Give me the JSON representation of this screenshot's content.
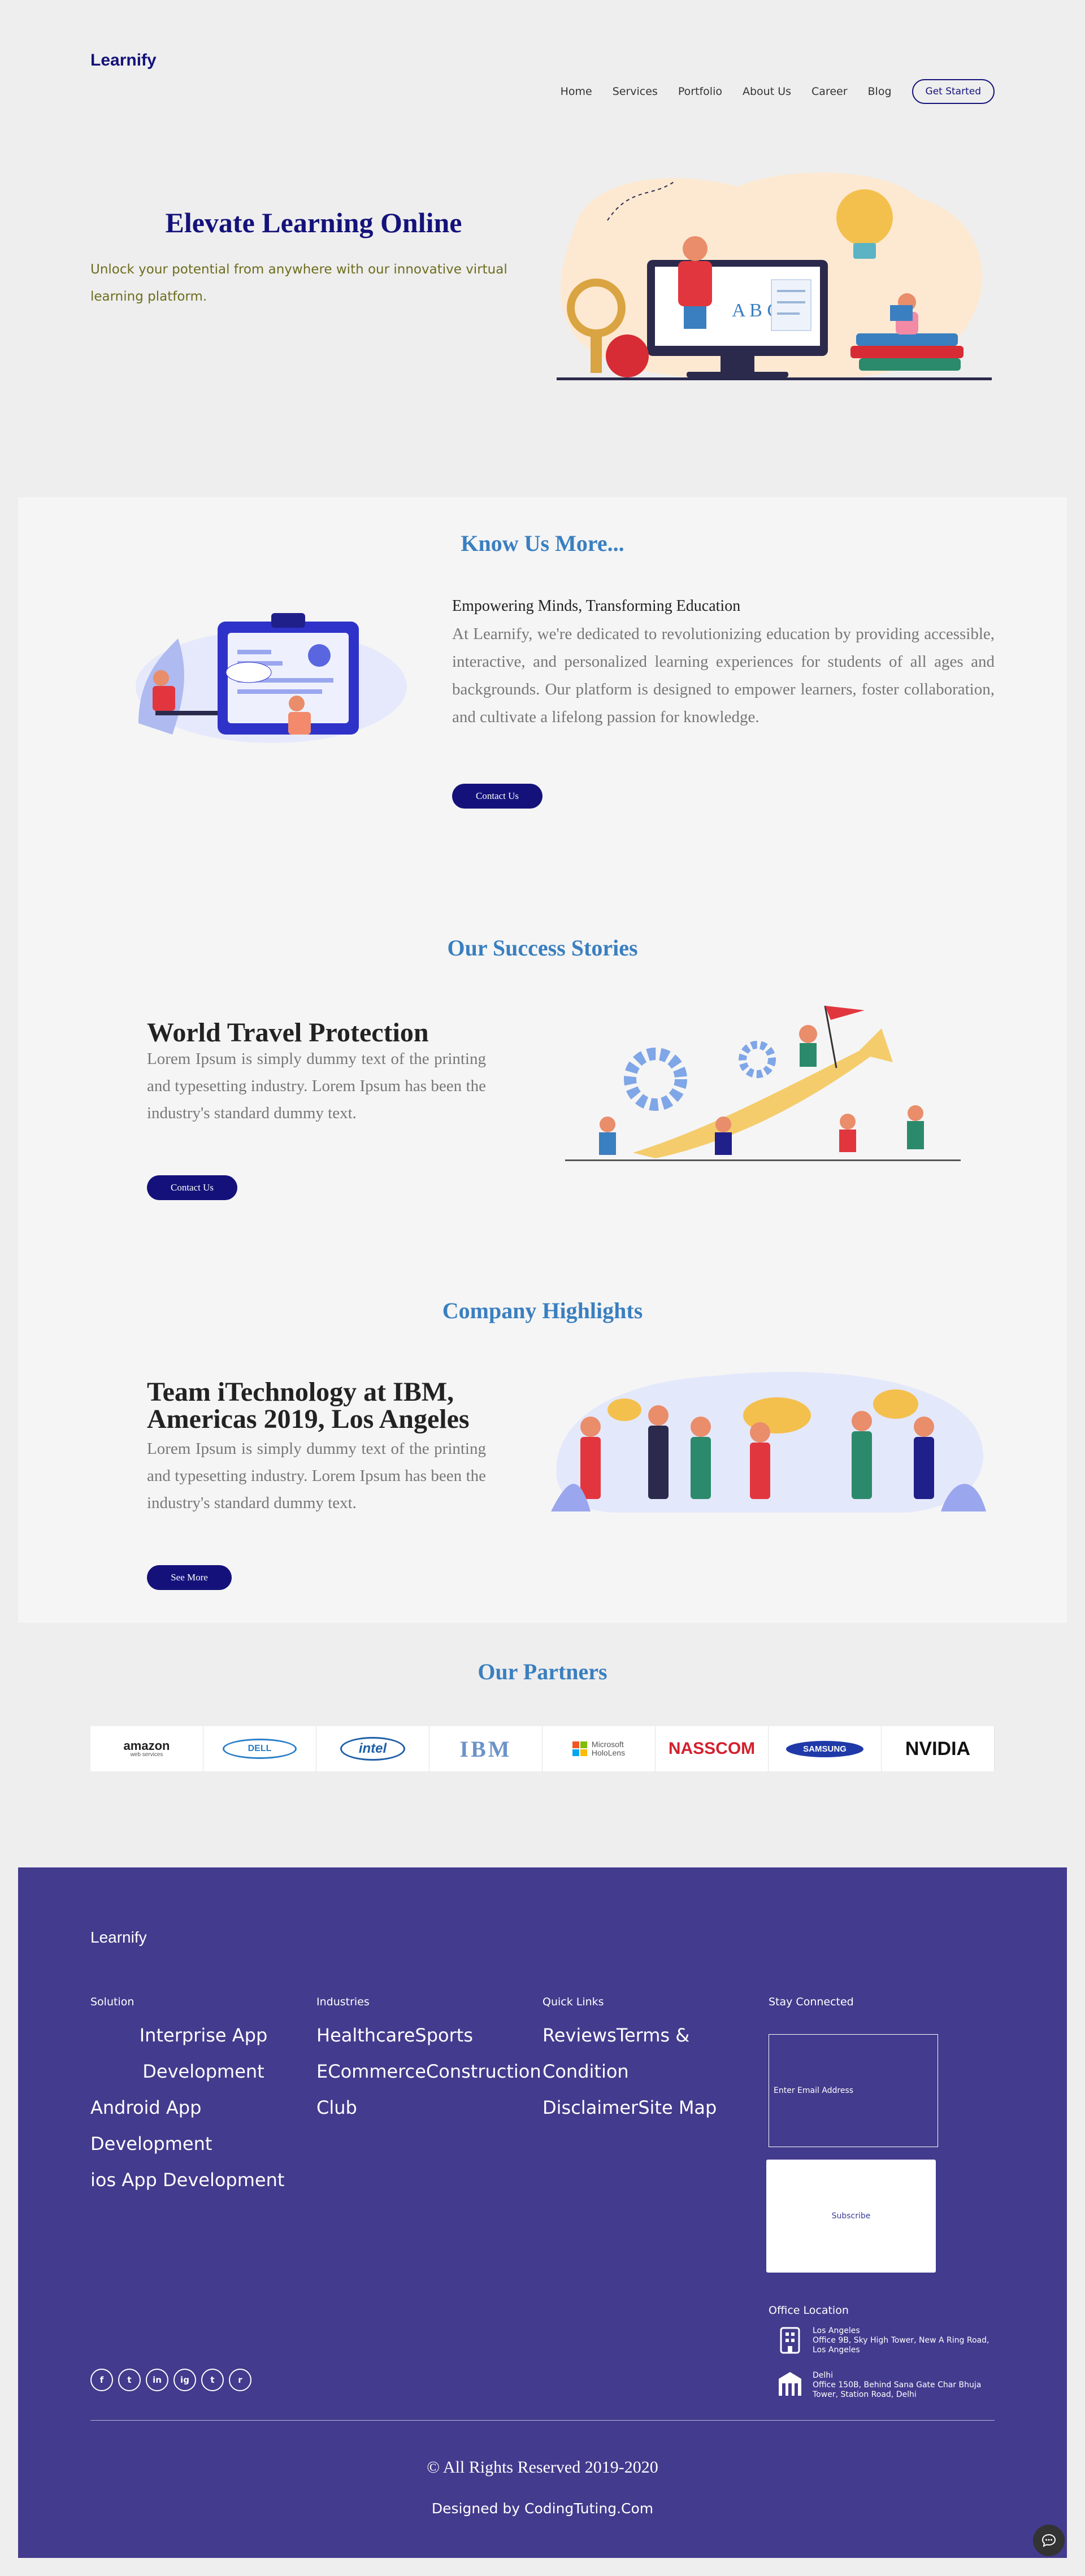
{
  "brand": "Learnify",
  "nav": {
    "items": [
      "Home",
      "Services",
      "Portfolio",
      "About Us",
      "Career",
      "Blog"
    ],
    "cta": "Get Started"
  },
  "hero": {
    "title": "Elevate Learning Online",
    "subtitle": "Unlock your potential from anywhere with our innovative virtual learning platform."
  },
  "know": {
    "title": "Know Us More...",
    "heading": "Empowering Minds, Transforming Education",
    "body": "At Learnify, we're dedicated to revolutionizing education by providing accessible, interactive, and personalized learning experiences for students of all ages and backgrounds. Our platform is designed to empower learners, foster collaboration, and cultivate a lifelong passion for knowledge.",
    "button": "Contact Us"
  },
  "success": {
    "title": "Our Success Stories",
    "heading": "World Travel Protection",
    "body": "Lorem Ipsum is simply dummy text of the printing and typesetting industry. Lorem Ipsum has been the industry's standard dummy text.",
    "button": "Contact Us"
  },
  "highlights": {
    "title": "Company Highlights",
    "heading_line1": "Team iTechnology at IBM,",
    "heading_line2": "Americas 2019, Los Angeles",
    "body": "Lorem Ipsum is simply dummy text of the printing and typesetting industry. Lorem Ipsum has been the industry's standard dummy text.",
    "button": "See More"
  },
  "partners": {
    "title": "Our Partners",
    "logos": [
      "amazon",
      "DELL",
      "intel",
      "IBM",
      "Microsoft HoloLens",
      "NASSCOM",
      "SAMSUNG",
      "NVIDIA"
    ],
    "amazon_sub": "web services",
    "ms_line1": "Microsoft",
    "ms_line2": "HoloLens"
  },
  "footer": {
    "brand": "Learnify",
    "solution": {
      "heading": "Solution",
      "items": [
        "Interprise App Development",
        "Android App Development",
        "ios App Development"
      ]
    },
    "industries": {
      "heading": "Industries",
      "items": [
        "HealthcareSports",
        "ECommerceConstruction",
        "Club"
      ]
    },
    "quick_links": {
      "heading": "Quick Links",
      "items": [
        "ReviewsTerms & Condition",
        "DisclaimerSite Map"
      ]
    },
    "stay_connected": {
      "heading": "Stay Connected",
      "email_placeholder": "Enter Email Address",
      "subscribe": "Subscribe"
    },
    "office": {
      "heading": "Office Location",
      "la_city": "Los Angeles",
      "la_address": "Office 9B, Sky High Tower, New A Ring Road, Los Angeles",
      "delhi_city": "Delhi",
      "delhi_address": "Office 150B, Behind Sana Gate Char Bhuja Tower, Station Road, Delhi"
    },
    "social": [
      "f",
      "t",
      "in",
      "ig",
      "t",
      "r"
    ],
    "copyright": "© All Rights Reserved 2019-2020",
    "designed_by": "Designed by CodingTuting.Com"
  },
  "colors": {
    "brand_navy": "#14127a",
    "accent_blue": "#3a7fc0",
    "footer_bg": "#433b8d",
    "hero_sub": "#6d6d1e"
  }
}
